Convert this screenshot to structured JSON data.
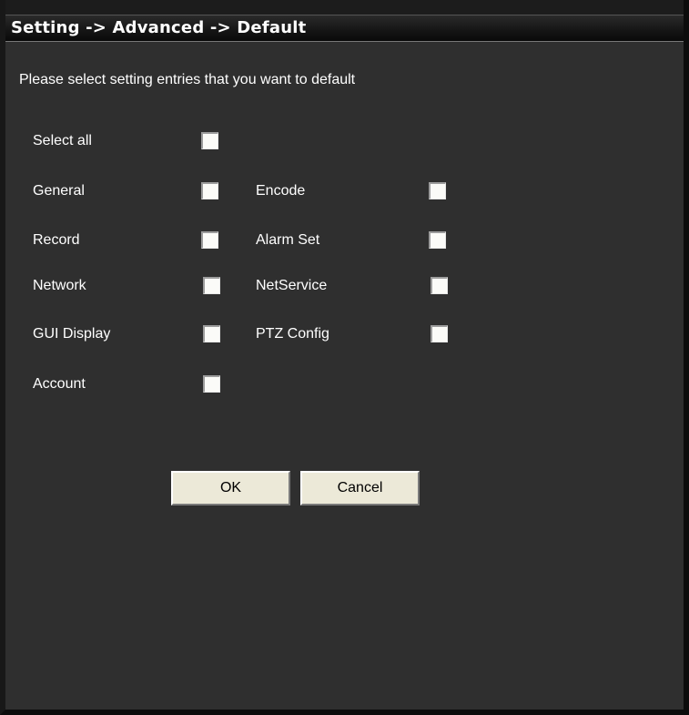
{
  "title": "Setting -> Advanced -> Default",
  "instruction": "Please select setting entries that you want to default",
  "select_all": {
    "label": "Select all",
    "checked": false
  },
  "entries": {
    "general": {
      "label": "General",
      "checked": false
    },
    "encode": {
      "label": "Encode",
      "checked": false
    },
    "record": {
      "label": "Record",
      "checked": false
    },
    "alarm_set": {
      "label": "Alarm Set",
      "checked": false
    },
    "network": {
      "label": "Network",
      "checked": false
    },
    "netservice": {
      "label": "NetService",
      "checked": false
    },
    "gui_display": {
      "label": "GUI Display",
      "checked": false
    },
    "ptz_config": {
      "label": "PTZ Config",
      "checked": false
    },
    "account": {
      "label": "Account",
      "checked": false
    }
  },
  "buttons": {
    "ok": "OK",
    "cancel": "Cancel"
  },
  "colors": {
    "background": "#2f2f2f",
    "text": "#ffffff",
    "button_face": "#ece9d8"
  }
}
